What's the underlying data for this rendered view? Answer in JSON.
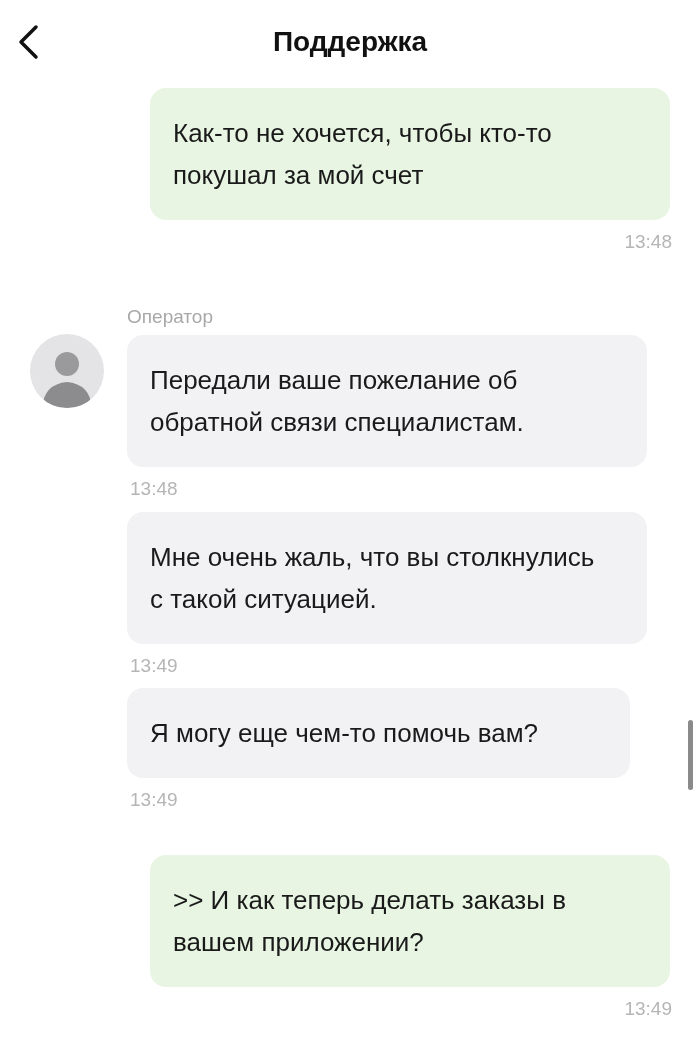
{
  "header": {
    "title": "Поддержка"
  },
  "messages": [
    {
      "kind": "outgoing",
      "text": "Как-то не хочется, чтобы кто-то покушал за мой счет",
      "time": "13:48"
    },
    {
      "kind": "incoming",
      "sender": "Оператор",
      "avatar": true,
      "text": "Передали ваше пожелание об обратной связи специалистам.",
      "time": "13:48"
    },
    {
      "kind": "incoming",
      "text": "Мне очень жаль, что вы столкнулись с такой ситуацией.",
      "time": "13:49"
    },
    {
      "kind": "incoming",
      "text": "Я могу еще чем-то помочь вам?",
      "time": "13:49"
    },
    {
      "kind": "outgoing",
      "text": ">> И как теперь делать заказы в вашем приложении?",
      "time": "13:49"
    }
  ]
}
